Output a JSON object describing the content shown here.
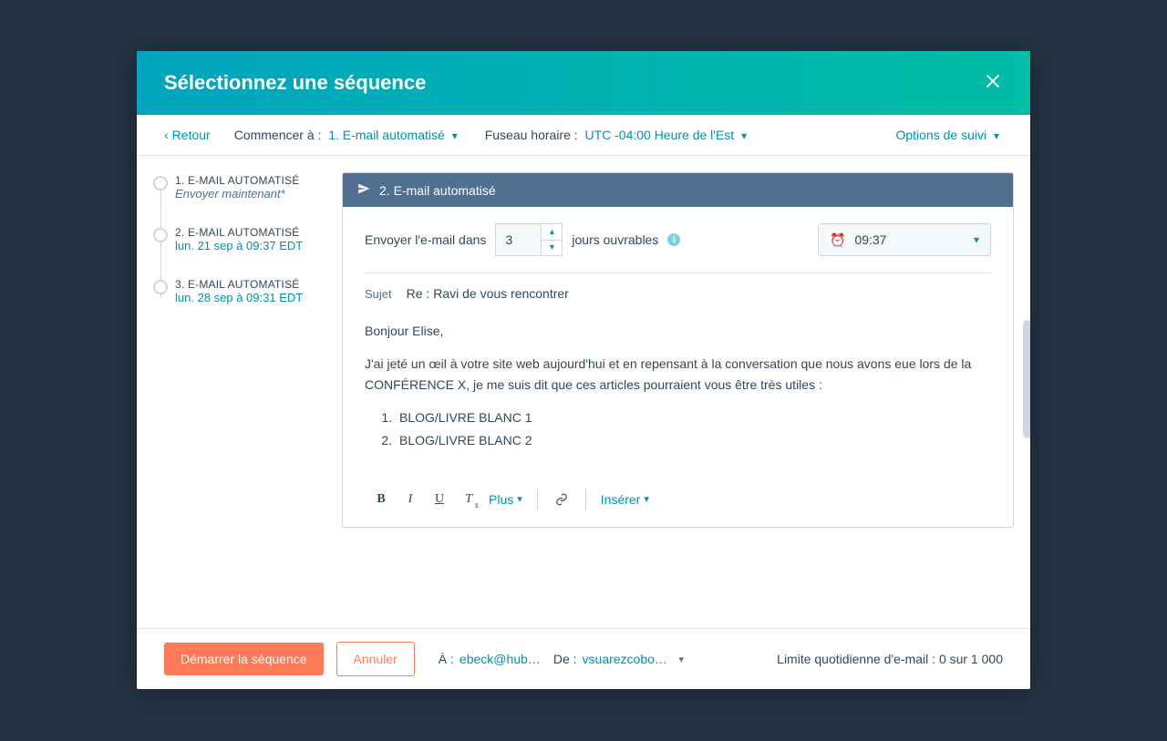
{
  "modal": {
    "title": "Sélectionnez une séquence"
  },
  "subheader": {
    "back": "Retour",
    "start_at_label": "Commencer à :",
    "start_at_value": "1. E-mail automatisé",
    "tz_label": "Fuseau horaire :",
    "tz_value": "UTC -04:00 Heure de l'Est",
    "tracking_options": "Options de suivi"
  },
  "steps": [
    {
      "title": "1. E-MAIL AUTOMATISÉ",
      "sub": "Envoyer maintenant*",
      "sub_style": "italic"
    },
    {
      "title": "2. E-MAIL AUTOMATISÉ",
      "sub": "lun. 21 sep à 09:37 EDT",
      "sub_style": "link"
    },
    {
      "title": "3. E-MAIL AUTOMATISÉ",
      "sub": "lun. 28 sep à 09:31 EDT",
      "sub_style": "link"
    }
  ],
  "editor": {
    "header_title": "2. E-mail automatisé",
    "delay_label": "Envoyer l'e-mail dans",
    "delay_value": "3",
    "delay_unit": "jours ouvrables",
    "time_value": "09:37",
    "subject_label": "Sujet",
    "subject_value": "Re : Ravi de vous rencontrer",
    "body": {
      "greeting": "Bonjour Elise,",
      "para": "J'ai jeté un œil à votre site web aujourd'hui et en repensant à la conversation que nous avons eue lors de la CONFÉRENCE X, je me suis dit que ces articles pourraient vous être très utiles :",
      "list": [
        "BLOG/LIVRE BLANC 1",
        "BLOG/LIVRE BLANC 2"
      ]
    },
    "toolbar": {
      "more": "Plus",
      "insert": "Insérer"
    }
  },
  "footer": {
    "start": "Démarrer la séquence",
    "cancel": "Annuler",
    "to_label": "À :",
    "to_value": "ebeck@hub…",
    "from_label": "De :",
    "from_value": "vsuarezcobos@h…",
    "limit_label": "Limite quotidienne d'e-mail :",
    "limit_value": "0 sur 1 000"
  }
}
